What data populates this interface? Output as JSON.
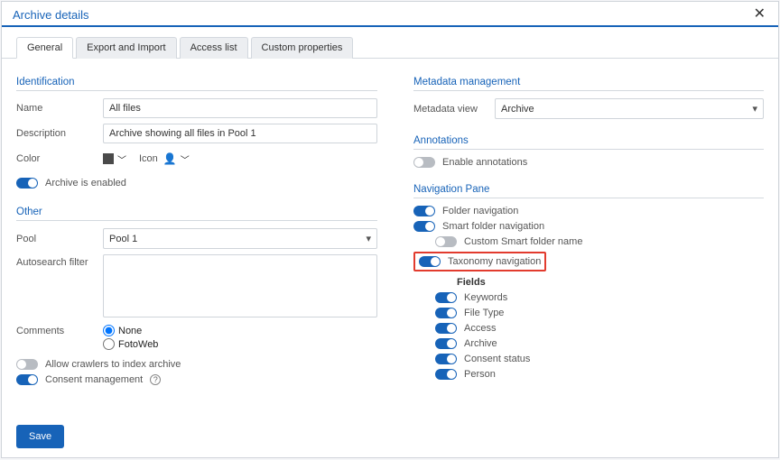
{
  "header": {
    "title": "Archive details"
  },
  "tabs": [
    "General",
    "Export and Import",
    "Access list",
    "Custom properties"
  ],
  "active_tab": 0,
  "left": {
    "identification": {
      "title": "Identification",
      "name_label": "Name",
      "name_value": "All files",
      "desc_label": "Description",
      "desc_value": "Archive showing all files in Pool 1",
      "color_label": "Color",
      "icon_label": "Icon",
      "enabled_label": "Archive is enabled",
      "enabled_on": true
    },
    "other": {
      "title": "Other",
      "pool_label": "Pool",
      "pool_value": "Pool 1",
      "autosearch_label": "Autosearch filter",
      "autosearch_value": "",
      "comments_label": "Comments",
      "comments_options": [
        "None",
        "FotoWeb"
      ],
      "comments_selected": "None",
      "crawlers_label": "Allow crawlers to index archive",
      "crawlers_on": false,
      "consent_label": "Consent management",
      "consent_on": true
    }
  },
  "right": {
    "metadata": {
      "title": "Metadata management",
      "view_label": "Metadata view",
      "view_value": "Archive"
    },
    "annotations": {
      "title": "Annotations",
      "enable_label": "Enable annotations",
      "enable_on": false
    },
    "nav": {
      "title": "Navigation Pane",
      "folder_label": "Folder navigation",
      "folder_on": true,
      "smart_label": "Smart folder navigation",
      "smart_on": true,
      "custom_label": "Custom Smart folder name",
      "custom_on": false,
      "taxonomy_label": "Taxonomy navigation",
      "taxonomy_on": true,
      "fields_heading": "Fields",
      "fields": [
        {
          "label": "Keywords",
          "on": true
        },
        {
          "label": "File Type",
          "on": true
        },
        {
          "label": "Access",
          "on": true
        },
        {
          "label": "Archive",
          "on": true
        },
        {
          "label": "Consent status",
          "on": true
        },
        {
          "label": "Person",
          "on": true
        }
      ]
    }
  },
  "footer": {
    "save_label": "Save"
  }
}
